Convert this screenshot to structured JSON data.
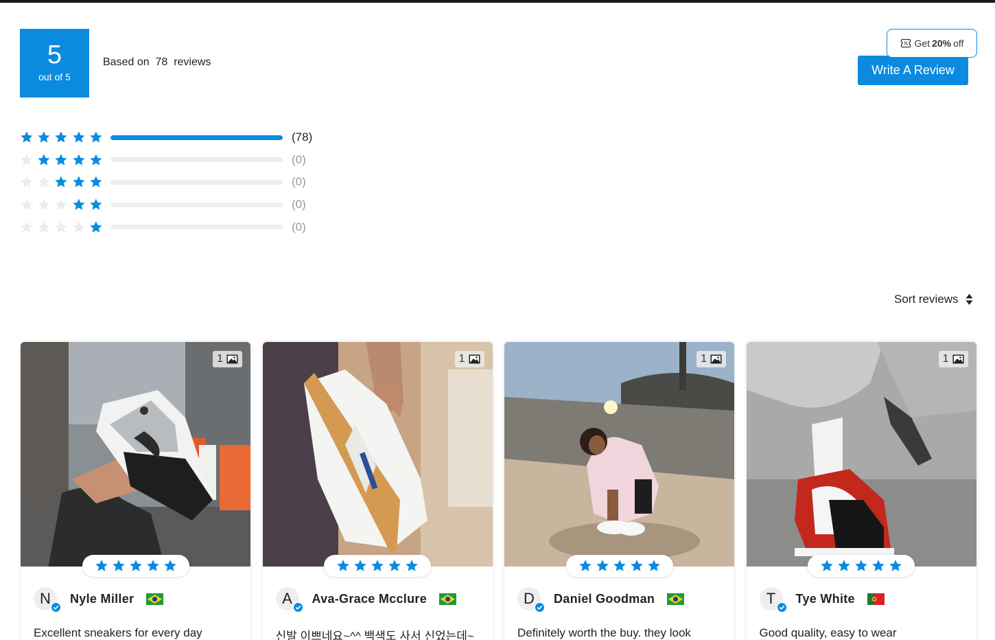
{
  "summary": {
    "score": "5",
    "score_sub": "out of 5",
    "based_on": "Based on  78  reviews"
  },
  "coupon": {
    "prefix": "Get",
    "amount": "20%",
    "suffix": "off",
    "icon": "ticket-icon"
  },
  "write_review_label": "Write A Review",
  "accent_color": "#0b8be0",
  "distribution": [
    {
      "stars": 5,
      "count_label": "(78)",
      "fraction": 1.0
    },
    {
      "stars": 4,
      "count_label": "(0)",
      "fraction": 0
    },
    {
      "stars": 3,
      "count_label": "(0)",
      "fraction": 0
    },
    {
      "stars": 2,
      "count_label": "(0)",
      "fraction": 0
    },
    {
      "stars": 1,
      "count_label": "(0)",
      "fraction": 0
    }
  ],
  "sort_label": "Sort reviews",
  "reviews": [
    {
      "initial": "N",
      "name": "Nyle Miller",
      "flag": "brazil-flag",
      "rating": 5,
      "image_count": "1",
      "text": "Excellent sneakers for every day"
    },
    {
      "initial": "A",
      "name": "Ava-Grace Mcclure",
      "flag": "brazil-flag",
      "rating": 5,
      "image_count": "1",
      "text": "신발 이쁘네요~^^ 백색도 사서 신었는데~"
    },
    {
      "initial": "D",
      "name": "Daniel Goodman",
      "flag": "brazil-flag",
      "rating": 5,
      "image_count": "1",
      "text": "Definitely worth the buy. they look"
    },
    {
      "initial": "T",
      "name": "Tye White",
      "flag": "portugal-flag",
      "rating": 5,
      "image_count": "1",
      "text": "Good quality, easy to wear"
    }
  ]
}
